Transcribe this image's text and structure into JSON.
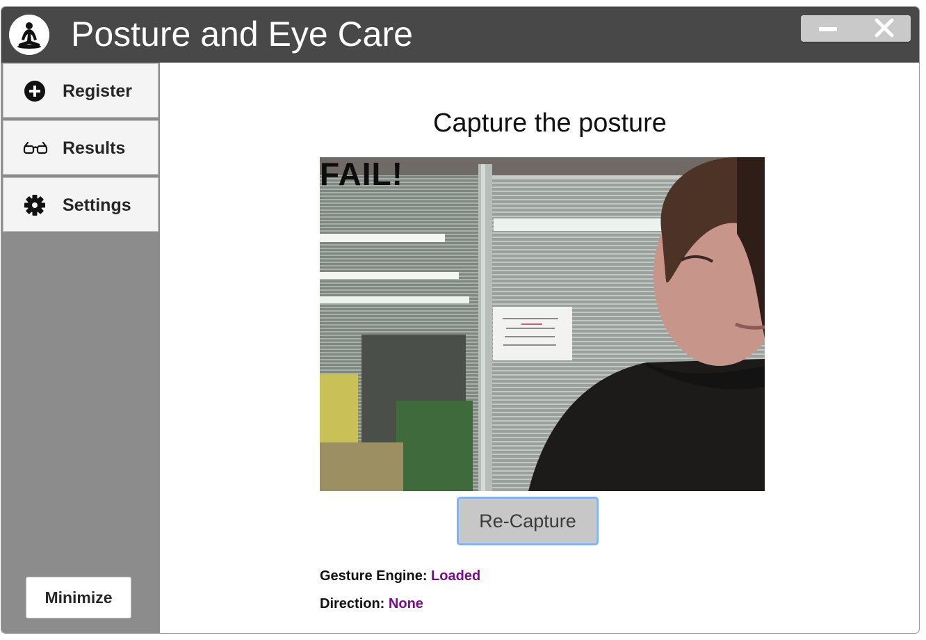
{
  "app": {
    "title": "Posture and Eye Care",
    "logo": "meditation-logo"
  },
  "window_controls": {
    "minimize_icon": "minus-icon",
    "close_icon": "close-icon"
  },
  "sidebar": {
    "items": [
      {
        "label": "Register",
        "icon": "plus-circle-icon"
      },
      {
        "label": "Results",
        "icon": "glasses-icon"
      },
      {
        "label": "Settings",
        "icon": "gear-icon"
      }
    ],
    "minimize_label": "Minimize"
  },
  "main": {
    "heading": "Capture the posture",
    "camera": {
      "overlay_text": "FAIL!"
    },
    "recapture_label": "Re-Capture",
    "status": {
      "gesture_label": "Gesture Engine:",
      "gesture_value": "Loaded",
      "direction_label": "Direction:",
      "direction_value": "None"
    }
  },
  "colors": {
    "titlebar": "#484848",
    "sidebar": "#8c8c8c",
    "status_value": "#7b0a8c",
    "focus_ring": "#7fb3f2"
  }
}
